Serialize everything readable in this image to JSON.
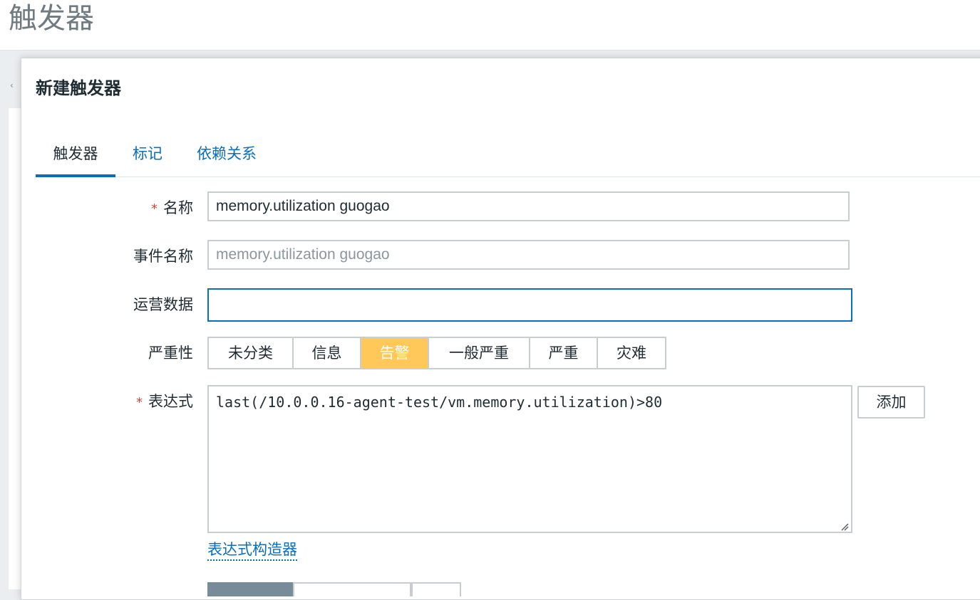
{
  "header": {
    "title": "触发器"
  },
  "dialog": {
    "title": "新建触发器",
    "tabs": [
      {
        "label": "触发器",
        "active": true
      },
      {
        "label": "标记",
        "active": false
      },
      {
        "label": "依赖关系",
        "active": false
      }
    ],
    "form": {
      "name": {
        "label": "名称",
        "required_mark": "*",
        "value": "memory.utilization guogao"
      },
      "event_name": {
        "label": "事件名称",
        "value": "",
        "placeholder": "memory.utilization guogao"
      },
      "opdata": {
        "label": "运营数据",
        "value": ""
      },
      "severity": {
        "label": "严重性",
        "options": [
          "未分类",
          "信息",
          "告警",
          "一般严重",
          "严重",
          "灾难"
        ],
        "selected": "告警"
      },
      "expression": {
        "label": "表达式",
        "required_mark": "*",
        "value": "last(/10.0.0.16-agent-test/vm.memory.utilization)>80",
        "add_button": "添加",
        "builder_link": "表达式构造器"
      }
    }
  },
  "colors": {
    "accent": "#0a6ebd",
    "severity_warning": "#ffc859",
    "required": "#d64541"
  }
}
